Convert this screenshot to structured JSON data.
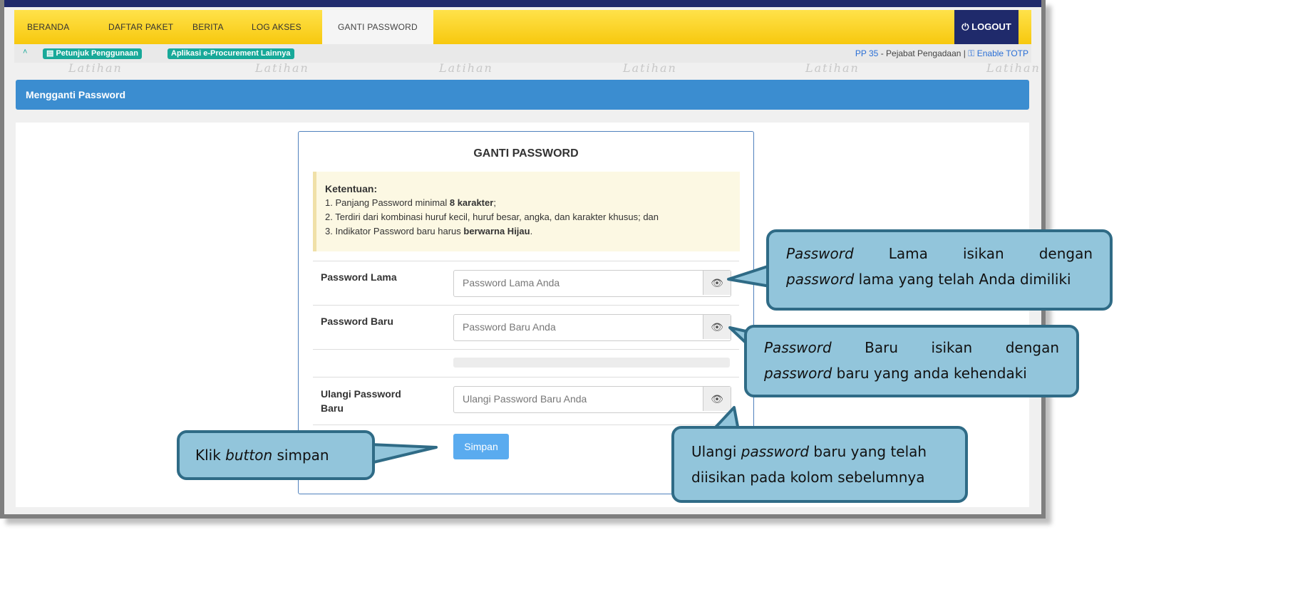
{
  "nav": {
    "items": [
      "BERANDA",
      "DAFTAR PAKET",
      "BERITA",
      "LOG AKSES",
      "GANTI PASSWORD"
    ],
    "logout": "LOGOUT"
  },
  "subbar": {
    "guide": "Petunjuk Penggunaan",
    "other_apps": "Aplikasi e-Procurement Lainnya",
    "user_code": "PP 35",
    "user_role": " - Pejabat Pengadaan | ",
    "totp": "Enable TOTP"
  },
  "watermark": "Latihan",
  "page_title": "Mengganti Password",
  "form": {
    "title": "GANTI PASSWORD",
    "rules_heading": "Ketentuan:",
    "rule1_pre": "1. Panjang Password minimal ",
    "rule1_bold": "8 karakter",
    "rule1_post": ";",
    "rule2": "2. Terdiri dari kombinasi huruf kecil, huruf besar, angka, dan karakter khusus; dan",
    "rule3_pre": "3. Indikator Password baru harus ",
    "rule3_bold": "berwarna Hijau",
    "rule3_post": ".",
    "old_label": "Password Lama",
    "old_placeholder": "Password Lama Anda",
    "new_label": "Password Baru",
    "new_placeholder": "Password Baru Anda",
    "repeat_label_1": "Ulangi Password",
    "repeat_label_2": "Baru",
    "repeat_placeholder": "Ulangi Password Baru Anda",
    "save": "Simpan"
  },
  "callouts": {
    "old": {
      "l1_italic": "Password",
      "l1_words": [
        "Lama",
        "isikan",
        "dengan"
      ],
      "l2_italic": "password",
      "l2_rest": " lama yang telah Anda dimiliki"
    },
    "new": {
      "l1_italic": "Password",
      "l1_words": [
        "Baru",
        "isikan",
        "dengan"
      ],
      "l2_italic": "password",
      "l2_rest": " baru yang anda kehendaki"
    },
    "repeat": {
      "l1_pre": "Ulangi ",
      "l1_italic": "password",
      "l1_post": " baru yang telah",
      "l2": "diisikan pada kolom sebelumnya"
    },
    "save": {
      "pre": "Klik ",
      "italic": "button",
      "post": " simpan"
    }
  },
  "icons": {
    "eye": "eye-icon",
    "power": "power-icon",
    "book": "book-icon",
    "key": "key-icon",
    "chevron": "chevron-up-icon"
  },
  "colors": {
    "navbar": "#f7c80e",
    "titlebar": "#3b8dd0",
    "badge": "#18a999",
    "callout_fill": "#92c5db",
    "callout_border": "#2f6b86",
    "save_button": "#5aabef"
  }
}
